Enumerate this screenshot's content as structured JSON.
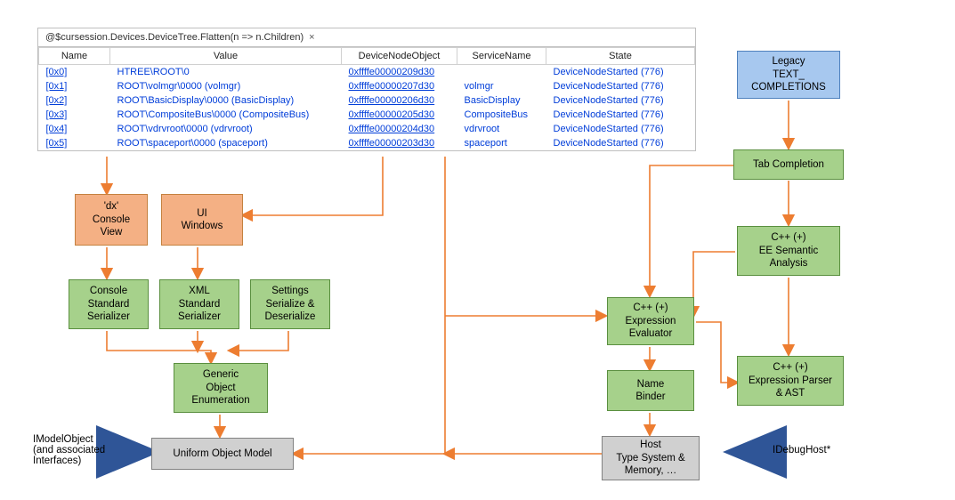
{
  "table": {
    "tab_title": "@$cursession.Devices.DeviceTree.Flatten(n => n.Children)",
    "close_glyph": "×",
    "columns": [
      "Name",
      "Value",
      "DeviceNodeObject",
      "ServiceName",
      "State"
    ],
    "rows": [
      {
        "name": "[0x0]",
        "value": "HTREE\\ROOT\\0",
        "obj": "0xffffe00000209d30",
        "svc": "",
        "state": "DeviceNodeStarted (776)"
      },
      {
        "name": "[0x1]",
        "value": "ROOT\\volmgr\\0000 (volmgr)",
        "obj": "0xffffe00000207d30",
        "svc": "volmgr",
        "state": "DeviceNodeStarted (776)"
      },
      {
        "name": "[0x2]",
        "value": "ROOT\\BasicDisplay\\0000 (BasicDisplay)",
        "obj": "0xffffe00000206d30",
        "svc": "BasicDisplay",
        "state": "DeviceNodeStarted (776)"
      },
      {
        "name": "[0x3]",
        "value": "ROOT\\CompositeBus\\0000 (CompositeBus)",
        "obj": "0xffffe00000205d30",
        "svc": "CompositeBus",
        "state": "DeviceNodeStarted (776)"
      },
      {
        "name": "[0x4]",
        "value": "ROOT\\vdrvroot\\0000 (vdrvroot)",
        "obj": "0xffffe00000204d30",
        "svc": "vdrvroot",
        "state": "DeviceNodeStarted (776)"
      },
      {
        "name": "[0x5]",
        "value": "ROOT\\spaceport\\0000 (spaceport)",
        "obj": "0xffffe00000203d30",
        "svc": "spaceport",
        "state": "DeviceNodeStarted (776)"
      }
    ]
  },
  "boxes": {
    "dx_console_view": "'dx'\nConsole\nView",
    "ui_windows": "UI\nWindows",
    "console_std_serializer": "Console\nStandard\nSerializer",
    "xml_std_serializer": "XML\nStandard\nSerializer",
    "settings_serialize": "Settings\nSerialize &\nDeserialize",
    "generic_obj_enum": "Generic\nObject\nEnumeration",
    "uniform_obj_model": "Uniform Object Model",
    "cpp_ee": "C++ (+)\nExpression\nEvaluator",
    "name_binder": "Name\nBinder",
    "host_type_system": "Host\nType System &\nMemory, …",
    "tab_completion": "Tab Completion",
    "cpp_semantic": "C++ (+)\nEE Semantic\nAnalysis",
    "cpp_parser_ast": "C++ (+)\nExpression Parser\n& AST",
    "legacy_text_comp": "Legacy\nTEXT_\nCOMPLETIONS"
  },
  "labels": {
    "imodel": "IModelObject\n(and associated\nInterfaces)",
    "idebughost": "IDebugHost*"
  },
  "colors": {
    "arrow_orange": "#ed7d31",
    "arrow_blue": "#2f5597"
  }
}
